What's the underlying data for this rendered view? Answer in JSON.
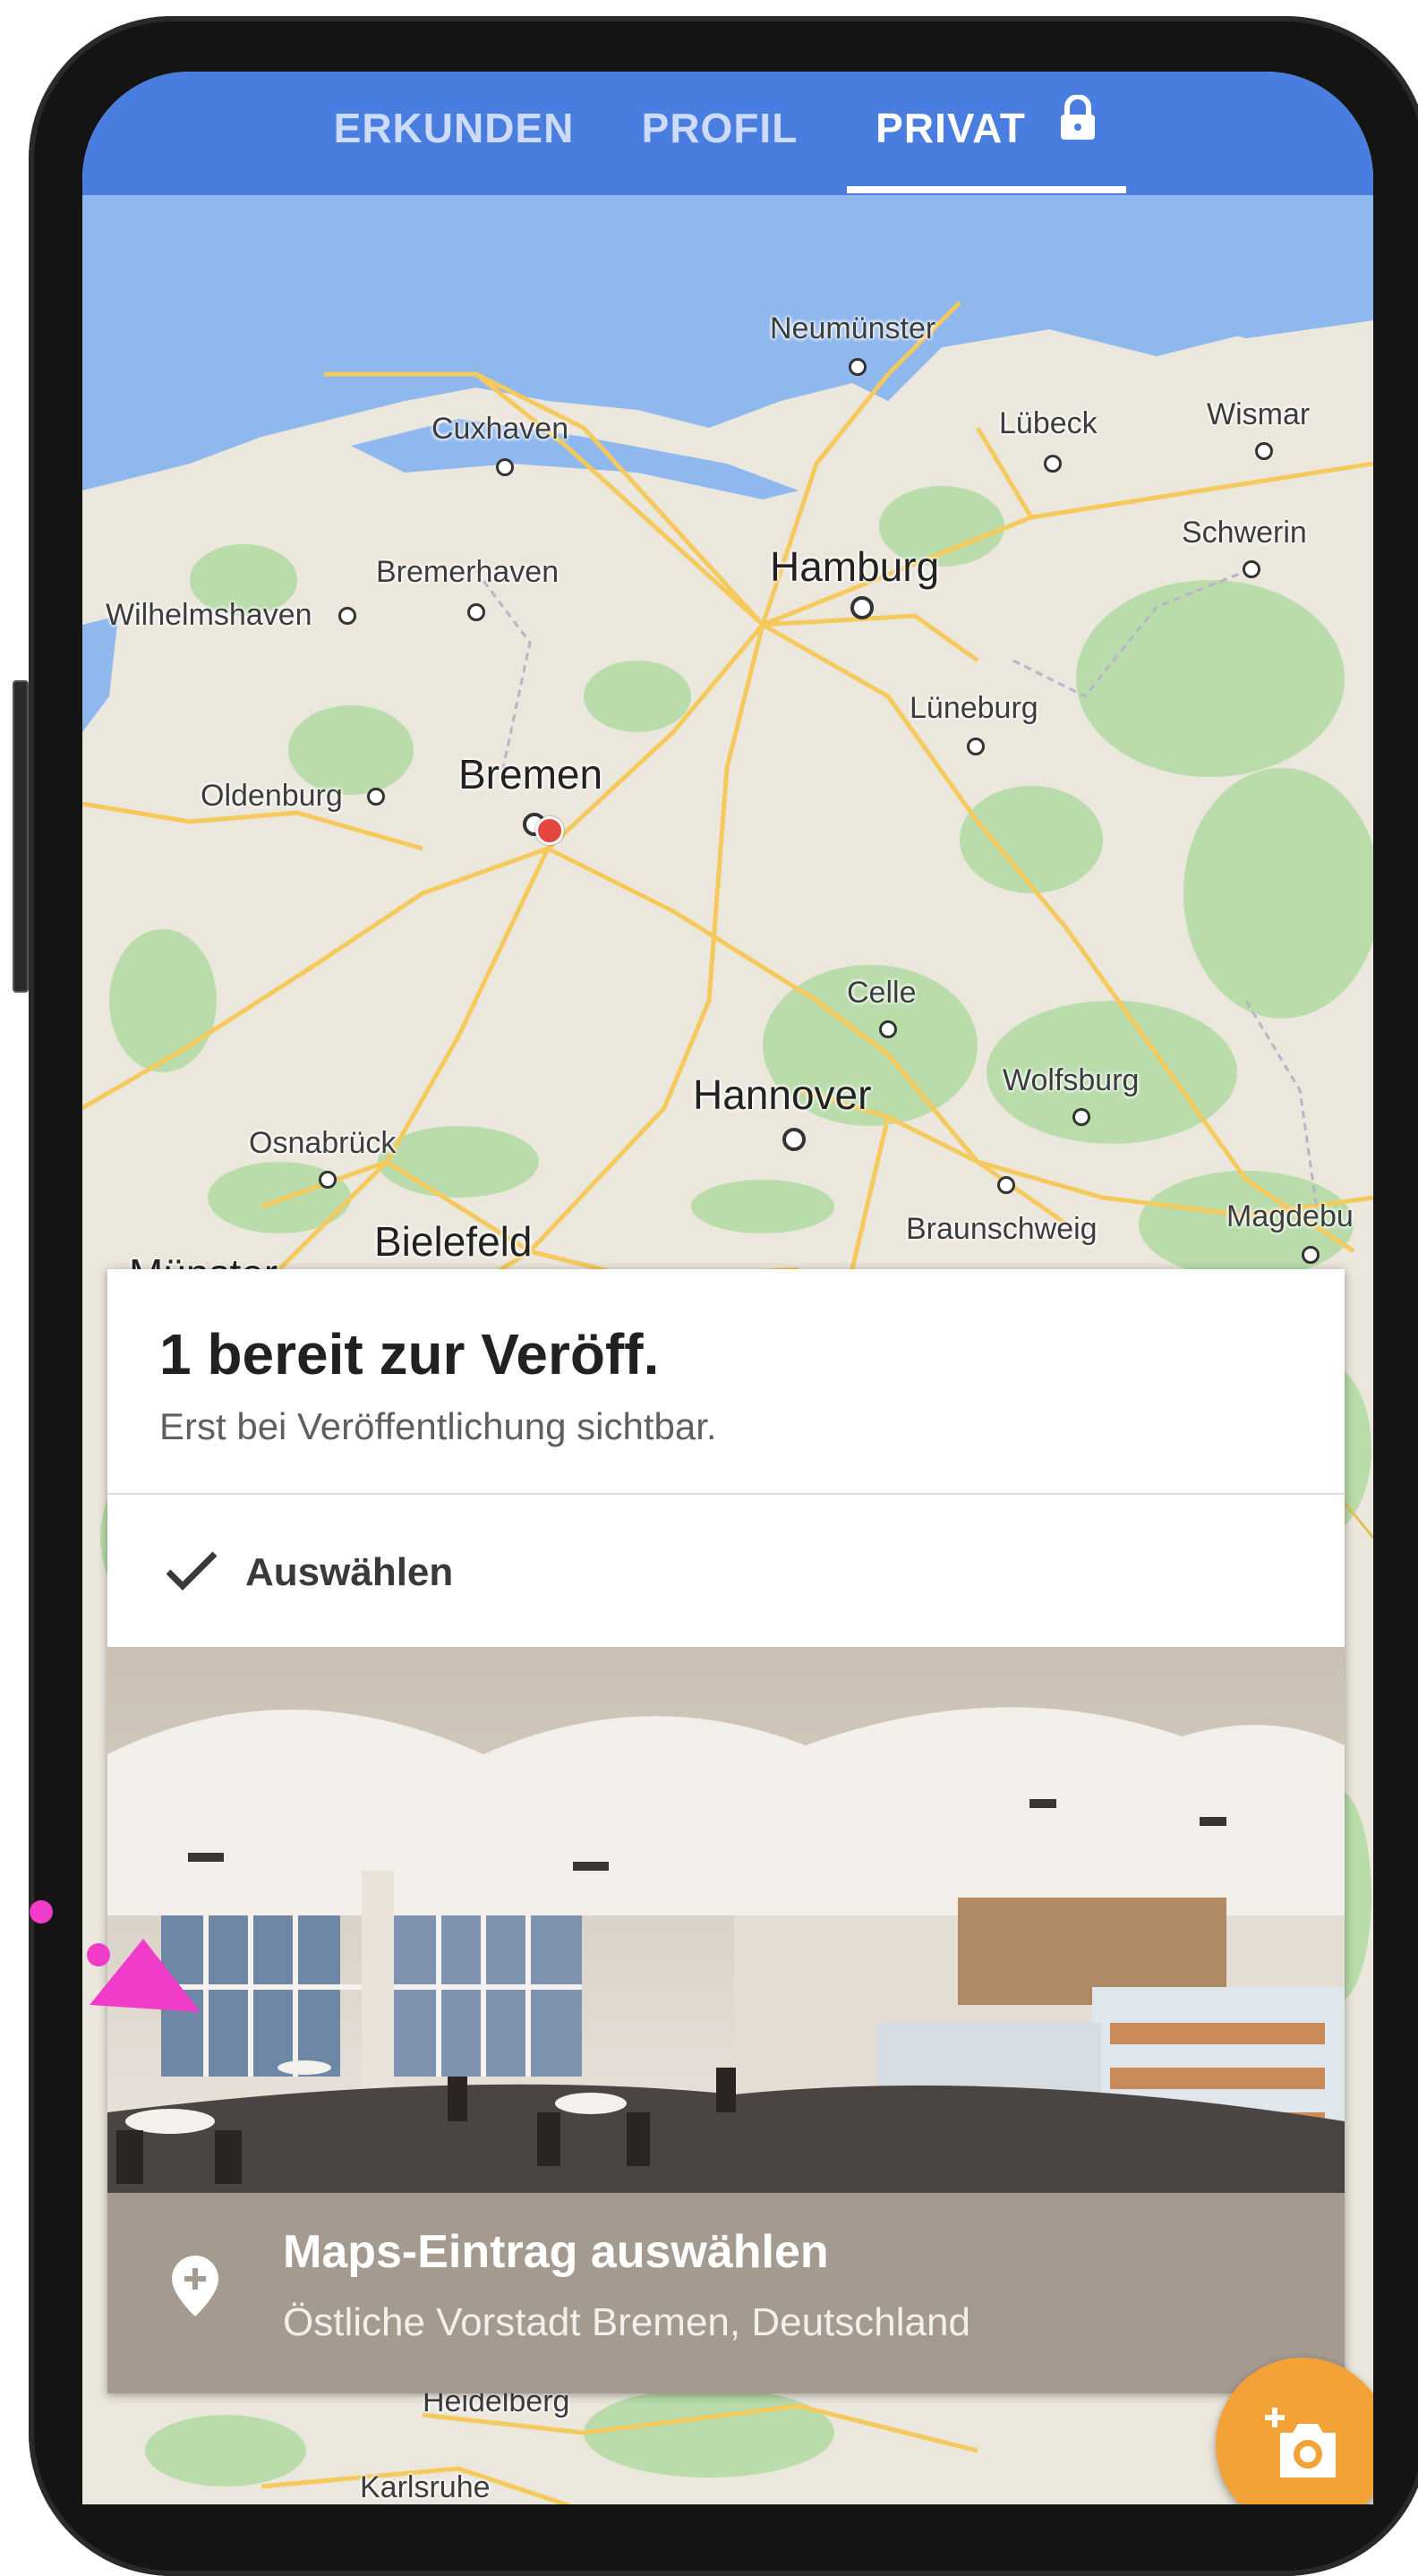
{
  "tabs": [
    {
      "label": "ERKUNDEN",
      "active": false
    },
    {
      "label": "PROFIL",
      "active": false
    },
    {
      "label": "PRIVAT",
      "active": true,
      "icon": "lock-icon"
    }
  ],
  "map": {
    "cities": {
      "neumuenster": "Neumünster",
      "cuxhaven": "Cuxhaven",
      "luebeck": "Lübeck",
      "wismar": "Wismar",
      "schwerin": "Schwerin",
      "hamburg": "Hamburg",
      "bremerhaven": "Bremerhaven",
      "wilhelmshaven": "Wilhelmshaven",
      "lueneburg": "Lüneburg",
      "oldenburg": "Oldenburg",
      "bremen": "Bremen",
      "celle": "Celle",
      "hannover": "Hannover",
      "wolfsburg": "Wolfsburg",
      "osnabrueck": "Osnabrück",
      "braunschweig": "Braunschweig",
      "magdeburg": "Magdebu",
      "bielefeld": "Bielefeld",
      "muenster": "Münster",
      "heidelberg": "Heidelberg",
      "karlsruhe": "Karlsruhe"
    }
  },
  "card": {
    "title": "1 bereit zur Veröff.",
    "subtitle": "Erst bei Veröffentlichung sichtbar.",
    "select_label": "Auswählen",
    "info_title": "Maps-Eintrag auswählen",
    "info_subtitle": "Östliche Vorstadt Bremen, Deutschland"
  },
  "colors": {
    "appbar": "#4a7de0",
    "fab": "#f2a236",
    "info_bar": "#a59a90",
    "pin": "#e5463f",
    "touch_indicator": "#f03cc8"
  }
}
